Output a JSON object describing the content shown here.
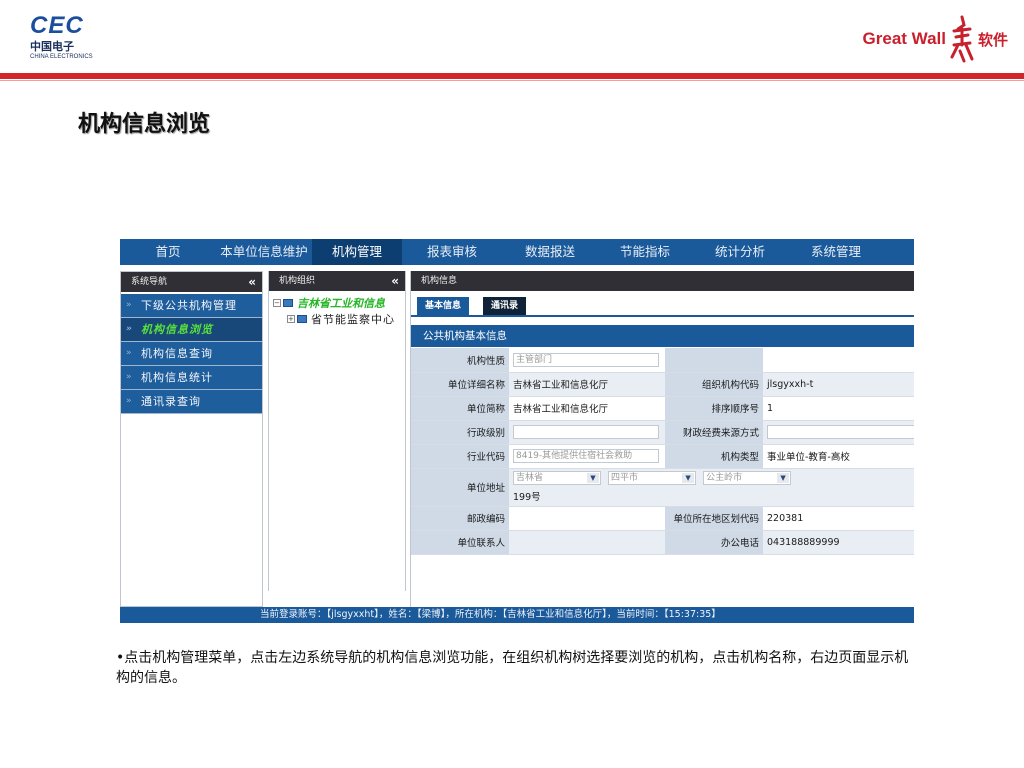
{
  "header": {
    "cec_logo": {
      "word": "CEC",
      "cn": "中国电子",
      "en": "CHINA ELECTRONICS"
    },
    "greatwall_logo": {
      "word": "Great Wall",
      "cn": "软件"
    },
    "accent_color": "#d4232b"
  },
  "slide_title": "机构信息浏览",
  "app": {
    "topnav": [
      "首页",
      "本单位信息维护",
      "机构管理",
      "报表审核",
      "数据报送",
      "节能指标",
      "统计分析",
      "系统管理"
    ],
    "topnav_active": "机构管理",
    "sidebar": {
      "title": "系统导航",
      "collapse": "«",
      "items": [
        "下级公共机构管理",
        "机构信息浏览",
        "机构信息查询",
        "机构信息统计",
        "通讯录查询"
      ],
      "active": "机构信息浏览"
    },
    "tree": {
      "title": "机构组织",
      "collapse": "«",
      "root": "吉林省工业和信息",
      "child": "省节能监察中心"
    },
    "main": {
      "title": "机构信息",
      "tabs": [
        "基本信息",
        "通讯录"
      ],
      "section_title": "公共机构基本信息",
      "fields": {
        "nature_label": "机构性质",
        "nature_value": "主管部门",
        "fullname_label": "单位详细名称",
        "fullname_value": "吉林省工业和信息化厅",
        "orgcode_label": "组织机构代码",
        "orgcode_value": "jlsgyxxh-t",
        "shortname_label": "单位简称",
        "shortname_value": "吉林省工业和信息化厅",
        "order_label": "排序顺序号",
        "order_value": "1",
        "admin_level_label": "行政级别",
        "admin_level_value": "",
        "funding_label": "财政经费来源方式",
        "funding_value": "",
        "industry_label": "行业代码",
        "industry_value": "8419-其他提供住宿社会救助",
        "type_label": "机构类型",
        "type_value": "事业单位-教育-高校",
        "address_label": "单位地址",
        "province": "吉林省",
        "city": "四平市",
        "district": "公主岭市",
        "street": "199号",
        "postcode_label": "邮政编码",
        "postcode_value": "",
        "region_label": "单位所在地区划代码",
        "region_value": "220381",
        "contact_label": "单位联系人",
        "contact_value": "",
        "phone_label": "办公电话",
        "phone_value": "043188889999"
      }
    },
    "statusbar": "当前登录账号：【jlsgyxxht】，姓名：【梁博】，所在机构：【吉林省工业和信息化厅】，当前时间：【15:37:35】"
  },
  "caption": "•点击机构管理菜单，点击左边系统导航的机构信息浏览功能，在组织机构树选择要浏览的机构，点击机构名称，右边页面显示机构的信息。"
}
